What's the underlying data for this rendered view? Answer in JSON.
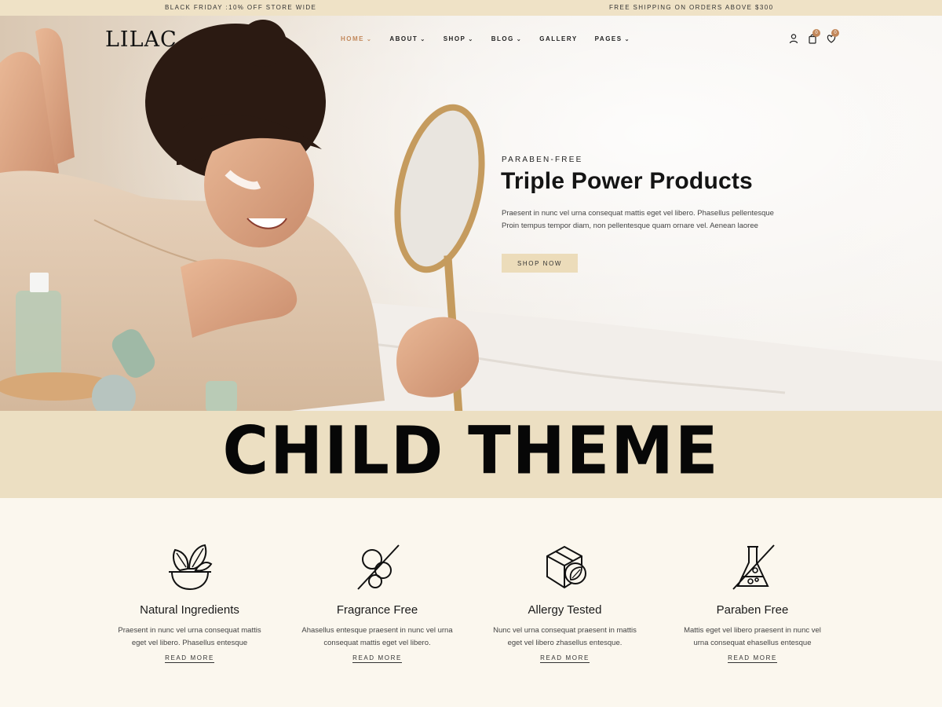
{
  "topbar": {
    "promo": "BLACK FRIDAY :10% OFF STORE WIDE",
    "shipping": "FREE SHIPPING ON ORDERS ABOVE $300"
  },
  "header": {
    "logo": "LILAC",
    "nav": [
      {
        "label": "HOME",
        "active": true,
        "dropdown": true
      },
      {
        "label": "ABOUT",
        "dropdown": true
      },
      {
        "label": "SHOP",
        "dropdown": true
      },
      {
        "label": "BLOG",
        "dropdown": true
      },
      {
        "label": "GALLERY",
        "dropdown": false
      },
      {
        "label": "PAGES",
        "dropdown": true
      }
    ],
    "cart_count": "0",
    "wishlist_count": "0"
  },
  "hero": {
    "eyebrow": "PARABEN-FREE",
    "title": "Triple Power Products",
    "text_line1": "Praesent in nunc vel urna consequat mattis eget vel libero. Phasellus pellentesque",
    "text_line2": "Proin tempus tempor diam, non pellentesque quam ornare vel. Aenean laoree",
    "button": "SHOP NOW"
  },
  "band": {
    "text": "CHILD THEME"
  },
  "features": [
    {
      "icon": "herbal-bowl-icon",
      "title": "Natural Ingredients",
      "text": "Praesent in nunc vel urna consequat mattis eget vel libero. Phasellus entesque",
      "link": "READ MORE"
    },
    {
      "icon": "no-fragrance-icon",
      "title": "Fragrance Free",
      "text": "Ahasellus entesque praesent in nunc vel urna consequat mattis eget vel libero.",
      "link": "READ MORE"
    },
    {
      "icon": "leaf-box-icon",
      "title": "Allergy Tested",
      "text": "Nunc vel urna consequat praesent in mattis eget vel libero zhasellus entesque.",
      "link": "READ MORE"
    },
    {
      "icon": "no-paraben-flask-icon",
      "title": "Paraben Free",
      "text": "Mattis eget vel libero praesent in nunc vel urna consequat ehasellus entesque",
      "link": "READ MORE"
    }
  ],
  "colors": {
    "accent": "#c2875a",
    "topbar": "#efe2c6",
    "band": "#ecdfc2",
    "button": "#ecdcba",
    "page_bg": "#fbf7ee"
  }
}
